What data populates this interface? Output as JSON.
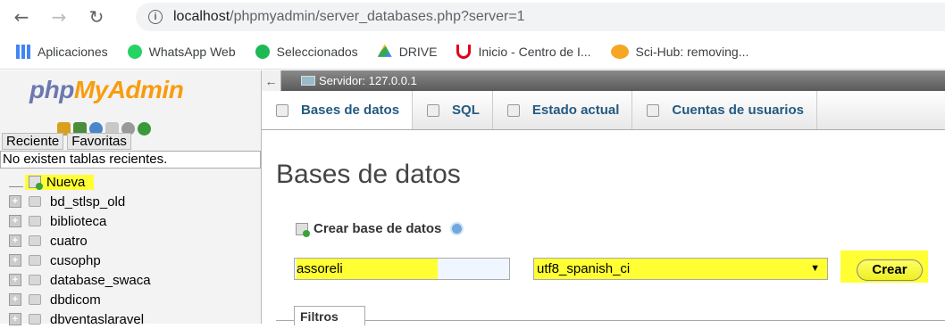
{
  "browser": {
    "url_host": "localhost",
    "url_path": "/phpmyadmin/server_databases.php?server=1",
    "bookmarks": [
      "Aplicaciones",
      "WhatsApp Web",
      "Seleccionados",
      "DRIVE",
      "Inicio - Centro de I...",
      "Sci-Hub: removing..."
    ]
  },
  "sidebar": {
    "logo_php": "php",
    "logo_myadmin": "MyAdmin",
    "tabs": [
      "Reciente",
      "Favoritas"
    ],
    "recent_text": "No existen tablas recientes.",
    "new_label": "Nueva",
    "databases": [
      "bd_stlsp_old",
      "biblioteca",
      "cuatro",
      "cusophp",
      "database_swaca",
      "dbdicom",
      "dbventaslaravel"
    ]
  },
  "server": {
    "label": "Servidor: 127.0.0.1"
  },
  "tabs": [
    "Bases de datos",
    "SQL",
    "Estado actual",
    "Cuentas de usuarios"
  ],
  "page": {
    "title": "Bases de datos",
    "create_label": "Crear base de datos",
    "db_name_value": "assoreli",
    "collation_value": "utf8_spanish_ci",
    "create_button": "Crear",
    "filters_label": "Filtros"
  }
}
